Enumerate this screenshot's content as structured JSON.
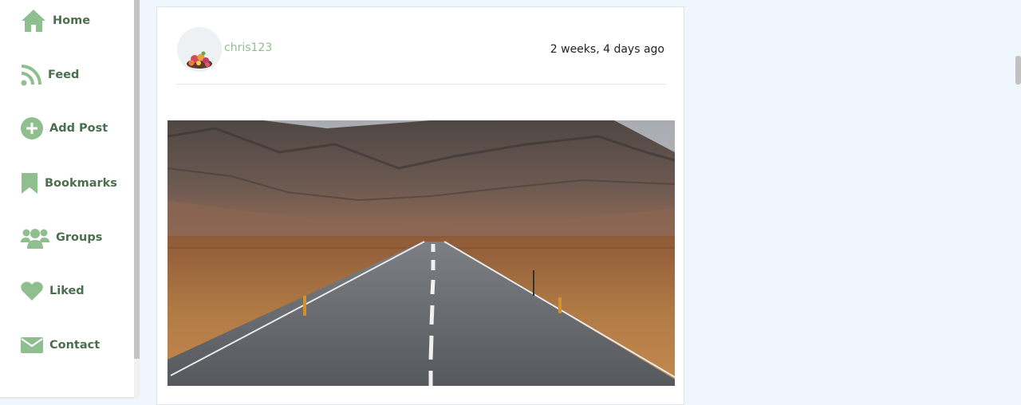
{
  "colors": {
    "accent": "#8fbf8f",
    "nav_text": "#4a6e4e",
    "page_background": "#eff6fe"
  },
  "sidebar": {
    "items": [
      {
        "label": "Home",
        "icon": "home-icon"
      },
      {
        "label": "Feed",
        "icon": "rss-feed-icon"
      },
      {
        "label": "Add Post",
        "icon": "plus-circle-icon"
      },
      {
        "label": "Bookmarks",
        "icon": "bookmark-icon"
      },
      {
        "label": "Groups",
        "icon": "users-icon"
      },
      {
        "label": "Liked",
        "icon": "heart-icon"
      },
      {
        "label": "Contact",
        "icon": "envelope-icon"
      }
    ]
  },
  "post": {
    "username": "chris123",
    "timestamp": "2 weeks, 4 days ago",
    "avatar_icon": "flower-avatar",
    "image": "mountain-road-photo"
  }
}
